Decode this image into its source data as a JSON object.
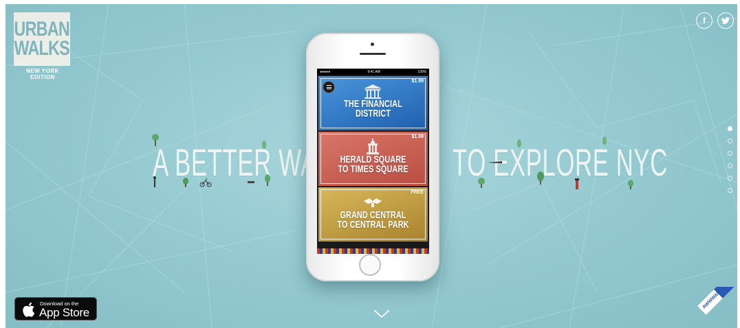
{
  "logo": {
    "line1": "URBAN",
    "line2": "WALKS",
    "edition": "NEW YORK EDITION"
  },
  "social": {
    "facebook": "f",
    "twitter": "t"
  },
  "headline": {
    "left": "A BETTER WAY",
    "right": "TO EXPLORE NYC"
  },
  "phone": {
    "status": {
      "carrier": "●●●●● ",
      "time": "9:41 AM",
      "battery": "100%"
    },
    "cards": [
      {
        "line1": "THE FINANCIAL",
        "line2": "DISTRICT",
        "price": "$1.99",
        "color": "#2f78c4"
      },
      {
        "line1": "HERALD SQUARE",
        "line2": "TO TIMES SQUARE",
        "price": "$1.99",
        "color": "#cc6355"
      },
      {
        "line1": "GRAND CENTRAL",
        "line2": "TO CENTRAL PARK",
        "price": "FREE",
        "color": "#c9a33e"
      }
    ]
  },
  "pagination": {
    "count": 6,
    "active_index": 0
  },
  "appstore": {
    "small": "Download on the",
    "big": "App Store"
  },
  "ribbon": {
    "text": "AWWWARDS XMAS"
  },
  "colors": {
    "background": "#93c8cf",
    "text": "#eef4f1"
  }
}
